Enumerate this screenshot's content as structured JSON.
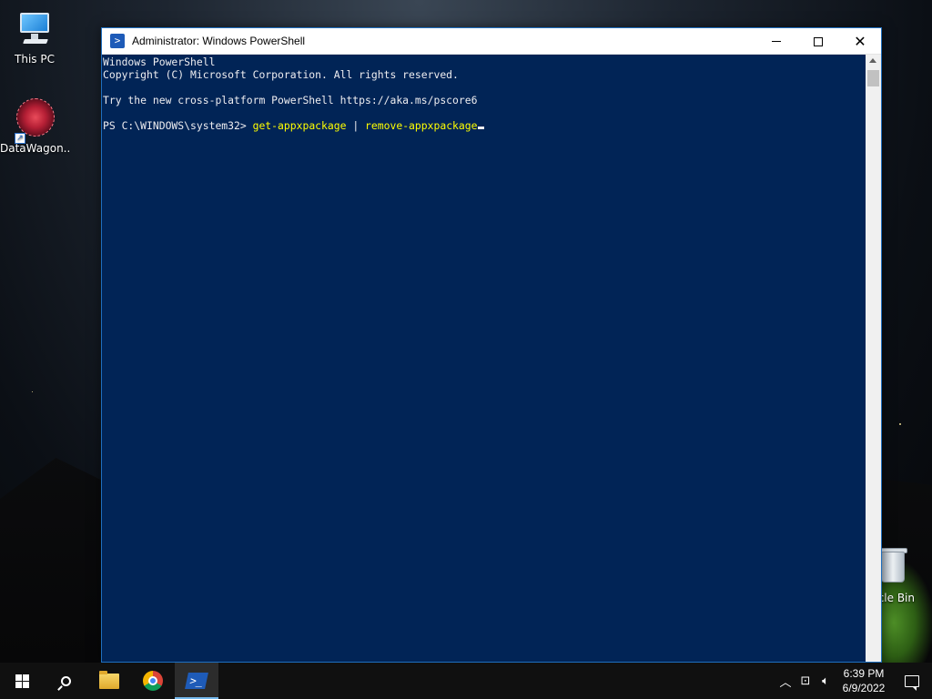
{
  "desktop": {
    "icons": [
      {
        "label": "This PC",
        "icon": "monitor-icon"
      },
      {
        "label": "DataWagon...",
        "icon": "datawagon-icon"
      },
      {
        "label": "cle Bin",
        "icon": "recycle-bin-icon"
      }
    ]
  },
  "window": {
    "title": "Administrator: Windows PowerShell",
    "controls": {
      "minimize": "minimize",
      "maximize": "maximize",
      "close": "close"
    },
    "console": {
      "line1": "Windows PowerShell",
      "line2": "Copyright (C) Microsoft Corporation. All rights reserved.",
      "line3": "",
      "line4": "Try the new cross-platform PowerShell https://aka.ms/pscore6",
      "line5": "",
      "prompt": "PS C:\\WINDOWS\\system32> ",
      "cmd_part1": "get-appxpackage",
      "pipe": " | ",
      "cmd_part2": "remove-appxpackage"
    },
    "colors": {
      "console_bg": "#012456",
      "command_text": "#ffff00",
      "console_text": "#eeedf0"
    }
  },
  "taskbar": {
    "apps": [
      {
        "name": "start",
        "icon": "windows-logo-icon"
      },
      {
        "name": "search",
        "icon": "search-icon"
      },
      {
        "name": "file-explorer",
        "icon": "folder-icon"
      },
      {
        "name": "chrome",
        "icon": "chrome-icon"
      },
      {
        "name": "powershell",
        "icon": "powershell-icon",
        "active": true
      }
    ],
    "tray": {
      "chevron": "^",
      "time": "6:39 PM",
      "date": "6/9/2022"
    }
  }
}
